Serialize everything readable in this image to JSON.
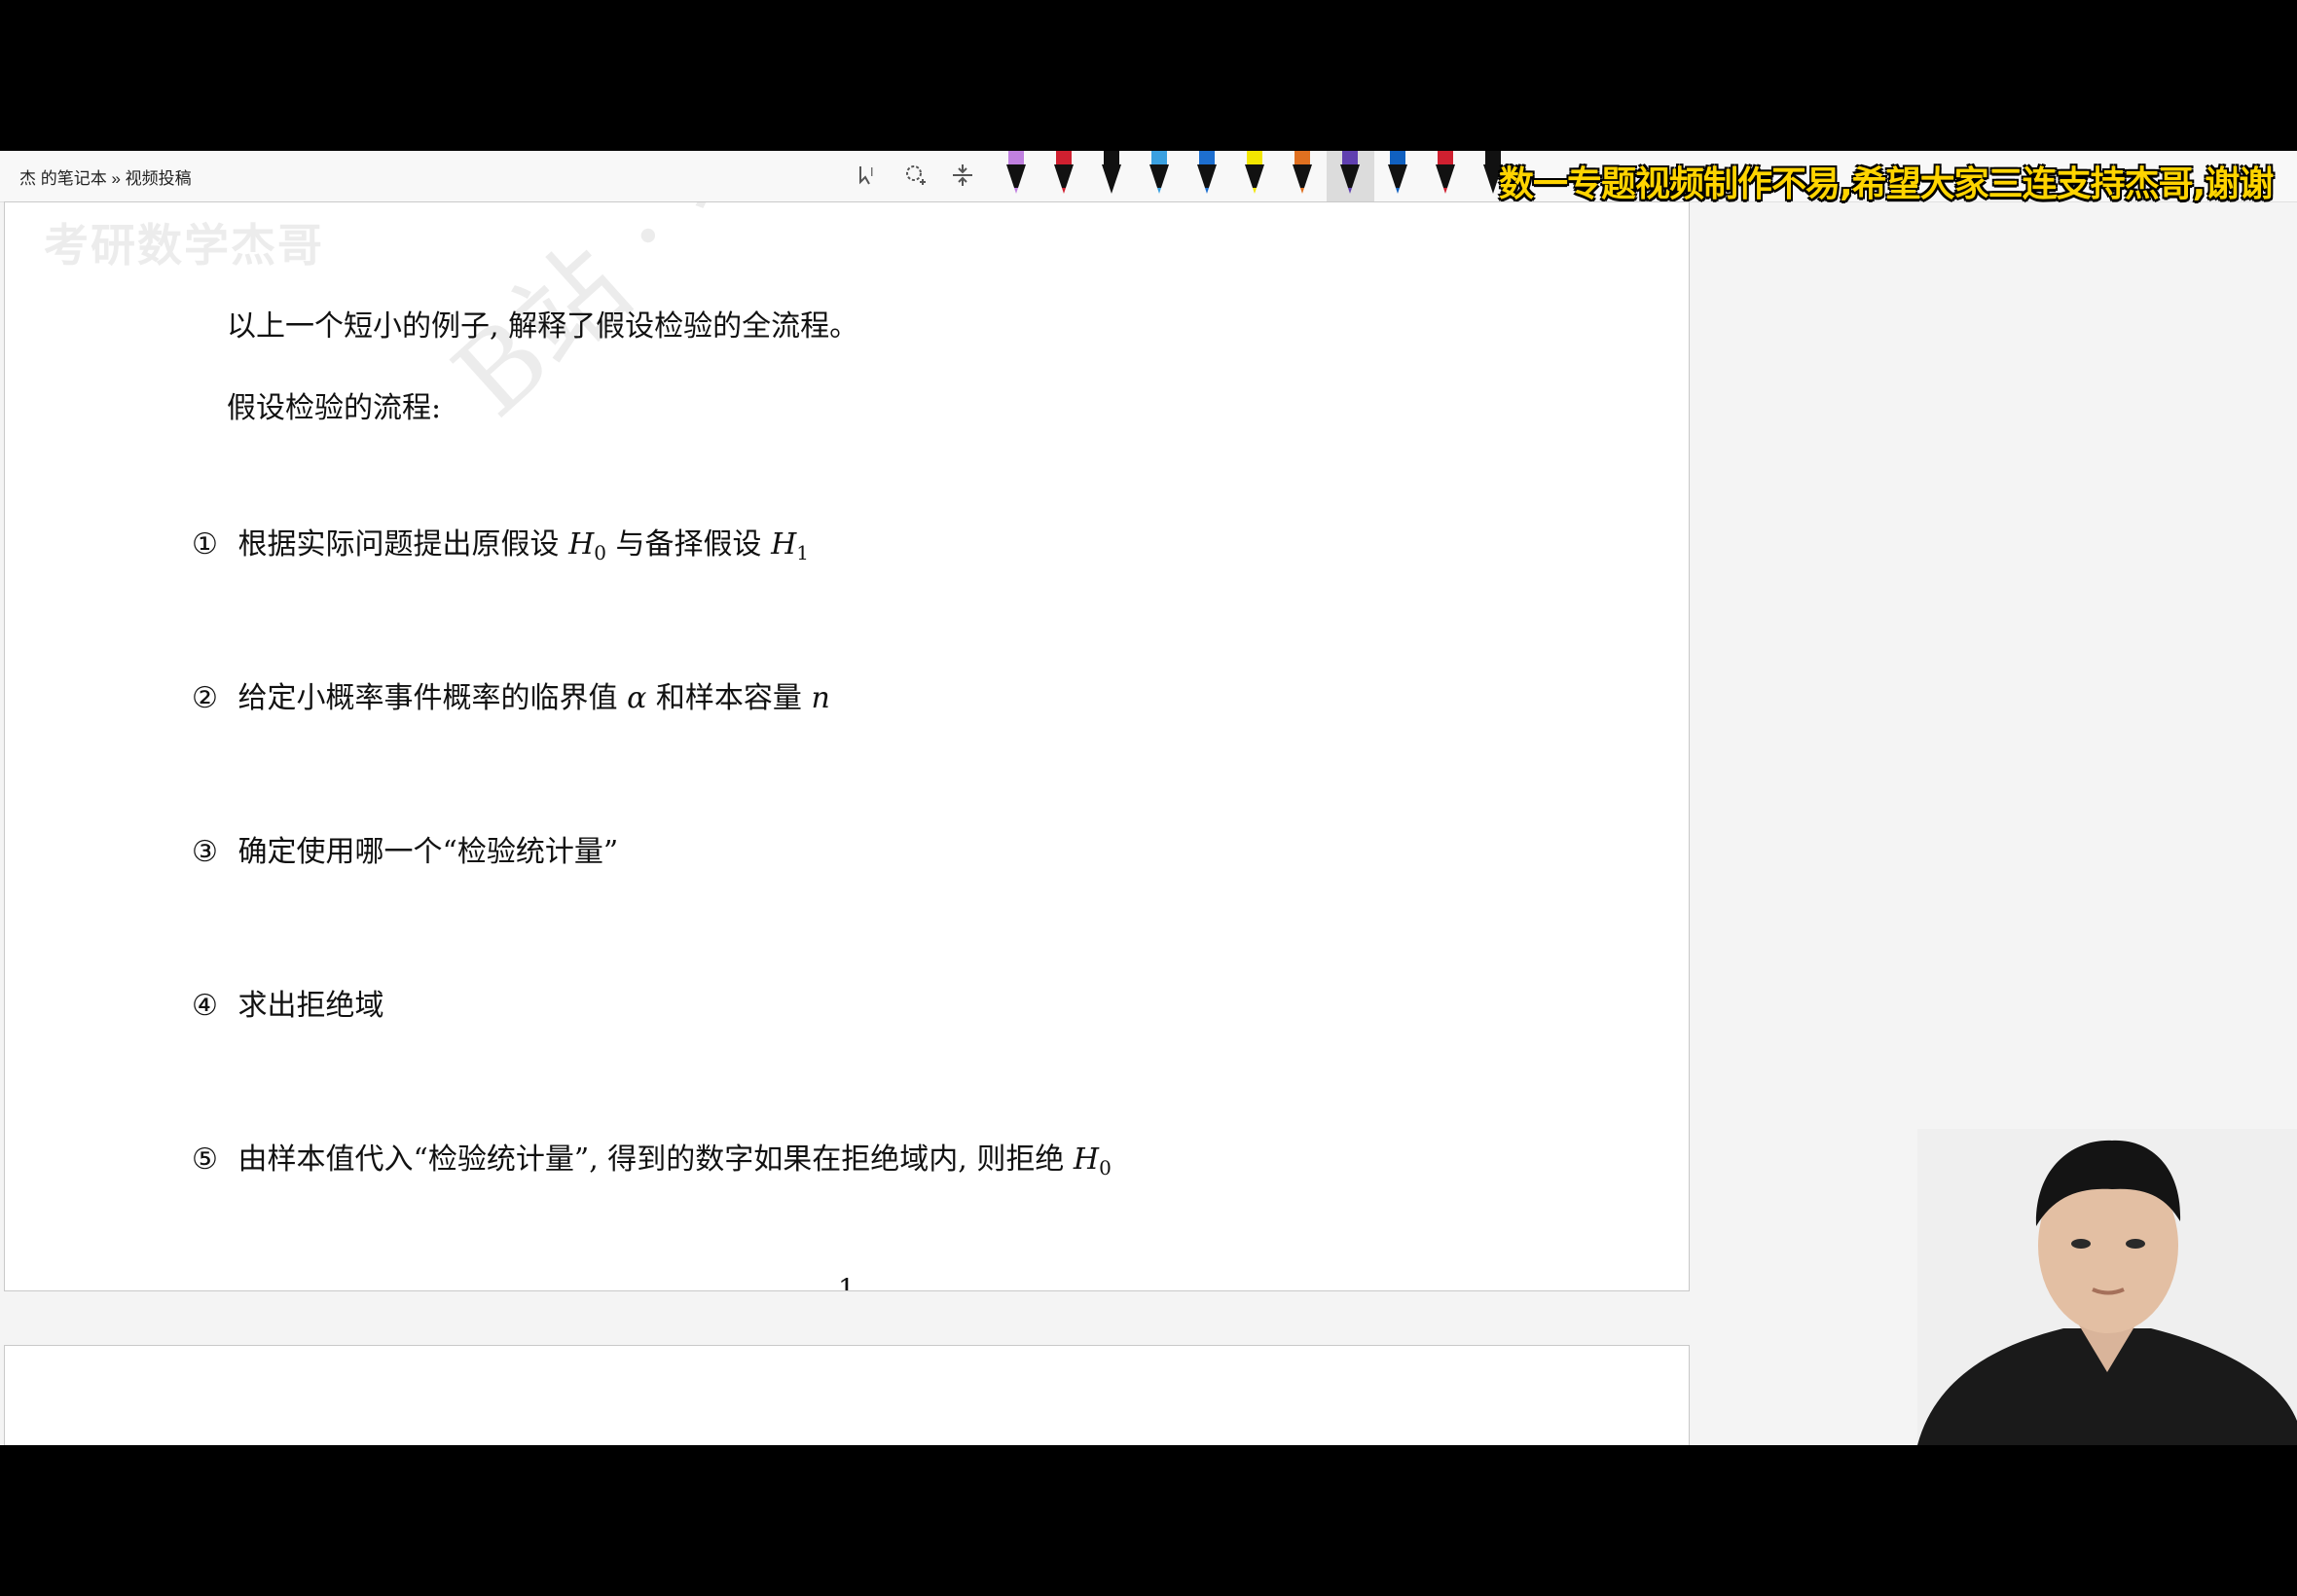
{
  "app": {
    "breadcrumb": "杰 的笔记本 » 视频投稿",
    "banner": "数一专题视频制作不易,希望大家三连支持杰哥,谢谢",
    "watermark": "B站 · 考研",
    "toolbar_icons": [
      "lasso-select-icon",
      "insert-space-icon",
      "zoom-icon"
    ],
    "pens": [
      {
        "color": "#c080e0",
        "type": "marker"
      },
      {
        "color": "#d02030",
        "type": "pen"
      },
      {
        "color": "#111111",
        "type": "pen"
      },
      {
        "color": "#3aa0e0",
        "type": "pen"
      },
      {
        "color": "#1d6fd0",
        "type": "pen"
      },
      {
        "color": "#f2e600",
        "type": "highlighter"
      },
      {
        "color": "#e07020",
        "type": "rainbow"
      },
      {
        "color": "#6040b0",
        "type": "pen",
        "selected": true
      },
      {
        "color": "#1060c0",
        "type": "pen"
      },
      {
        "color": "#d02030",
        "type": "pen"
      },
      {
        "color": "#111111",
        "type": "pen"
      }
    ]
  },
  "document": {
    "intro": "以上一个短小的例子, 解释了假设检验的全流程。",
    "process_heading": "假设检验的流程:",
    "steps": [
      {
        "marker": "①",
        "text": "根据实际问题提出原假设",
        "math1": "H",
        "sub1": "0",
        "mid": "与备择假设",
        "math2": "H",
        "sub2": "1"
      },
      {
        "marker": "②",
        "text": "给定小概率事件概率的临界值",
        "math1": "α",
        "mid": "和样本容量",
        "math2": "n"
      },
      {
        "marker": "③",
        "text": "确定使用哪一个“检验统计量”"
      },
      {
        "marker": "④",
        "text": "求出拒绝域"
      },
      {
        "marker": "⑤",
        "text": "由样本值代入“检验统计量”, 得到的数字如果在拒绝域内, 则拒绝",
        "math1": "H",
        "sub1": "0"
      }
    ],
    "page_number": "1"
  }
}
